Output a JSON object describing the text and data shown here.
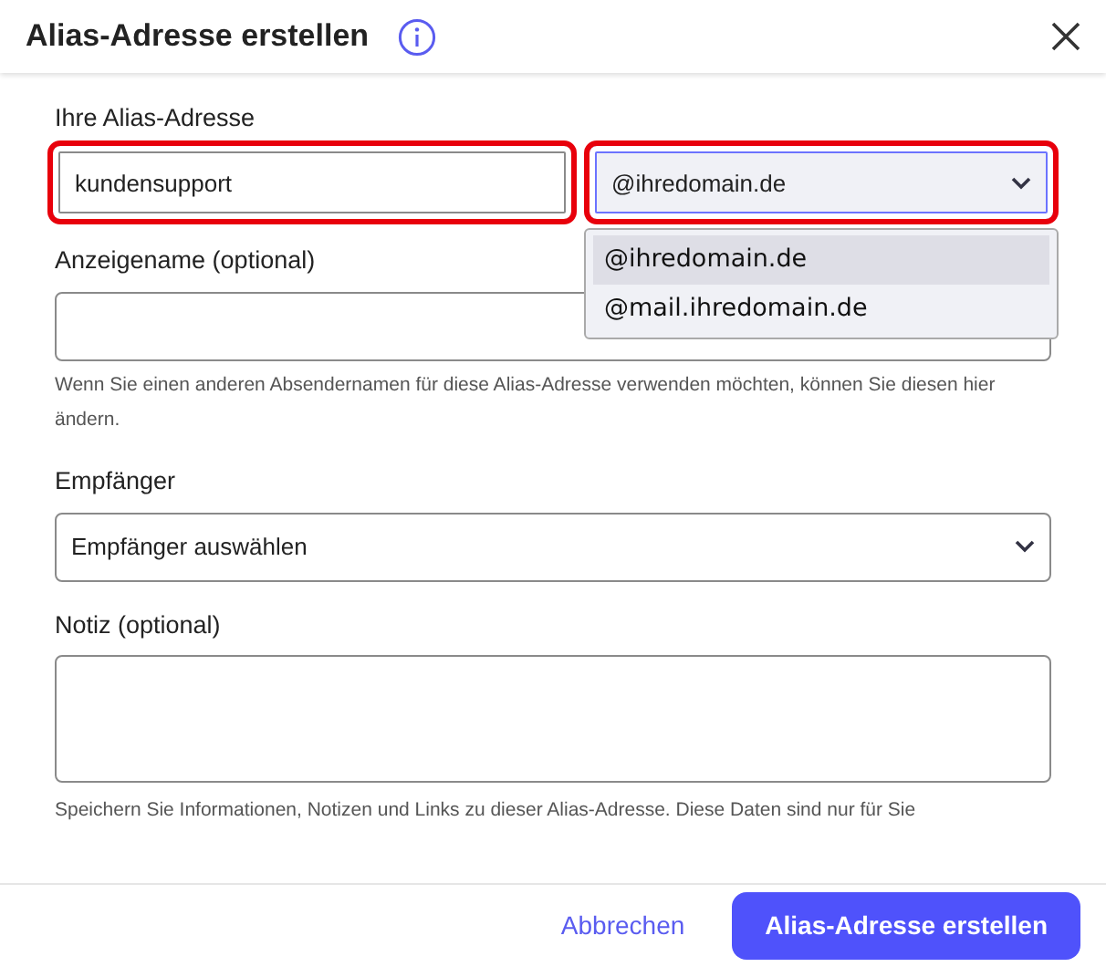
{
  "dialog": {
    "title": "Alias-Adresse erstellen"
  },
  "alias": {
    "label": "Ihre Alias-Adresse",
    "local_part": {
      "value": "kundensupport",
      "highlighted": true
    },
    "domain": {
      "value": "@ihredomain.de",
      "highlighted": true,
      "expanded": true,
      "options": [
        {
          "label": "@ihredomain.de",
          "selected": true
        },
        {
          "label": "@mail.ihredomain.de",
          "selected": false
        }
      ]
    }
  },
  "display_name": {
    "label": "Anzeigename (optional)",
    "help": "Wenn Sie einen anderen Absendernamen für diese Alias-Adresse verwenden möchten, können Sie diesen hier ändern."
  },
  "recipient": {
    "label": "Empfänger",
    "value": "Empfänger auswählen"
  },
  "note": {
    "label": "Notiz (optional)",
    "help": "Speichern Sie Informationen, Notizen und Links zu dieser Alias-Adresse. Diese Daten sind nur für Sie"
  },
  "buttons": [
    {
      "label": "Abbrechen",
      "kind": "link"
    },
    {
      "label": "Alias-Adresse erstellen",
      "kind": "primary"
    }
  ]
}
